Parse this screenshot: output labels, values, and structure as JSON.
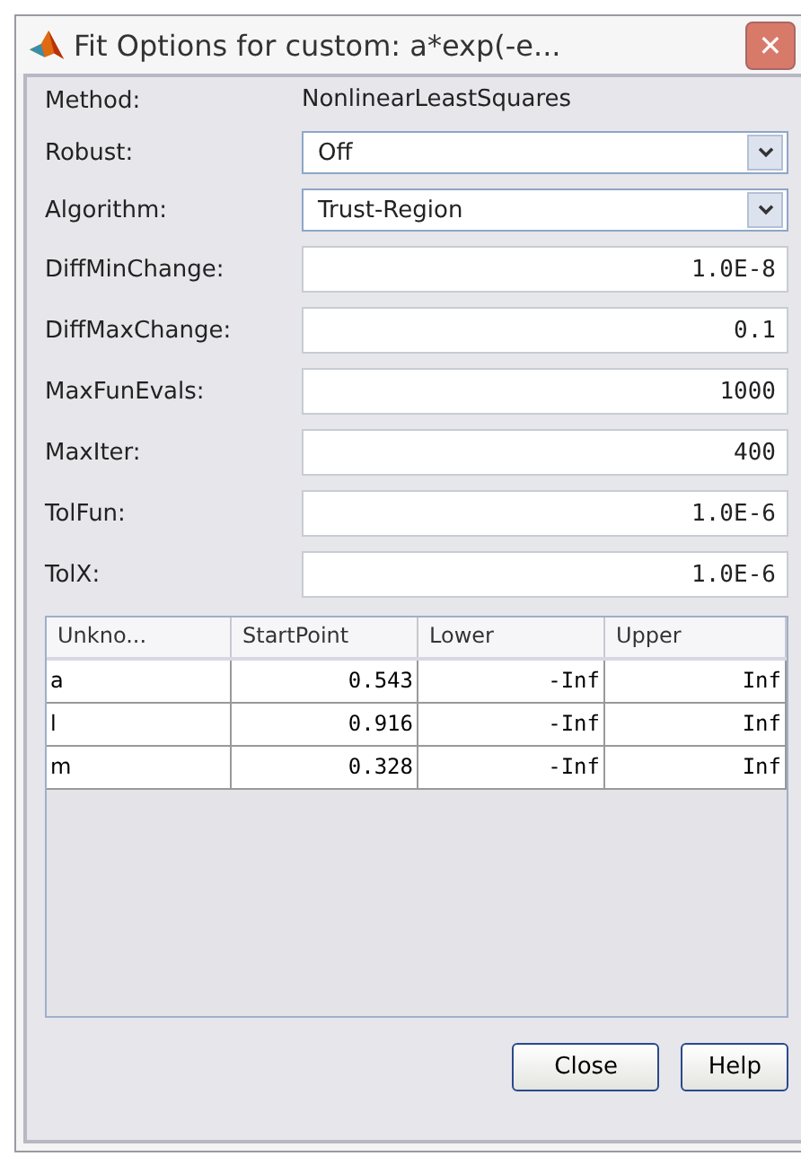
{
  "window": {
    "title": "Fit Options for custom: a*exp(-e...",
    "close": "✕"
  },
  "method": {
    "label": "Method:",
    "value": "NonlinearLeastSquares"
  },
  "fields": [
    {
      "kind": "dropdown",
      "label": "Robust:",
      "value": "Off"
    },
    {
      "kind": "dropdown",
      "label": "Algorithm:",
      "value": "Trust-Region"
    },
    {
      "kind": "text",
      "label": "DiffMinChange:",
      "value": "1.0E-8"
    },
    {
      "kind": "text",
      "label": "DiffMaxChange:",
      "value": "0.1"
    },
    {
      "kind": "text",
      "label": "MaxFunEvals:",
      "value": "1000"
    },
    {
      "kind": "text",
      "label": "MaxIter:",
      "value": "400"
    },
    {
      "kind": "text",
      "label": "TolFun:",
      "value": "1.0E-6"
    },
    {
      "kind": "text",
      "label": "TolX:",
      "value": "1.0E-6"
    }
  ],
  "table": {
    "columns": [
      "Unkno...",
      "StartPoint",
      "Lower",
      "Upper"
    ],
    "rows": [
      [
        "a",
        "0.543",
        "-Inf",
        "Inf"
      ],
      [
        "l",
        "0.916",
        "-Inf",
        "Inf"
      ],
      [
        "m",
        "0.328",
        "-Inf",
        "Inf"
      ]
    ]
  },
  "buttons": [
    "Close",
    "Help"
  ]
}
